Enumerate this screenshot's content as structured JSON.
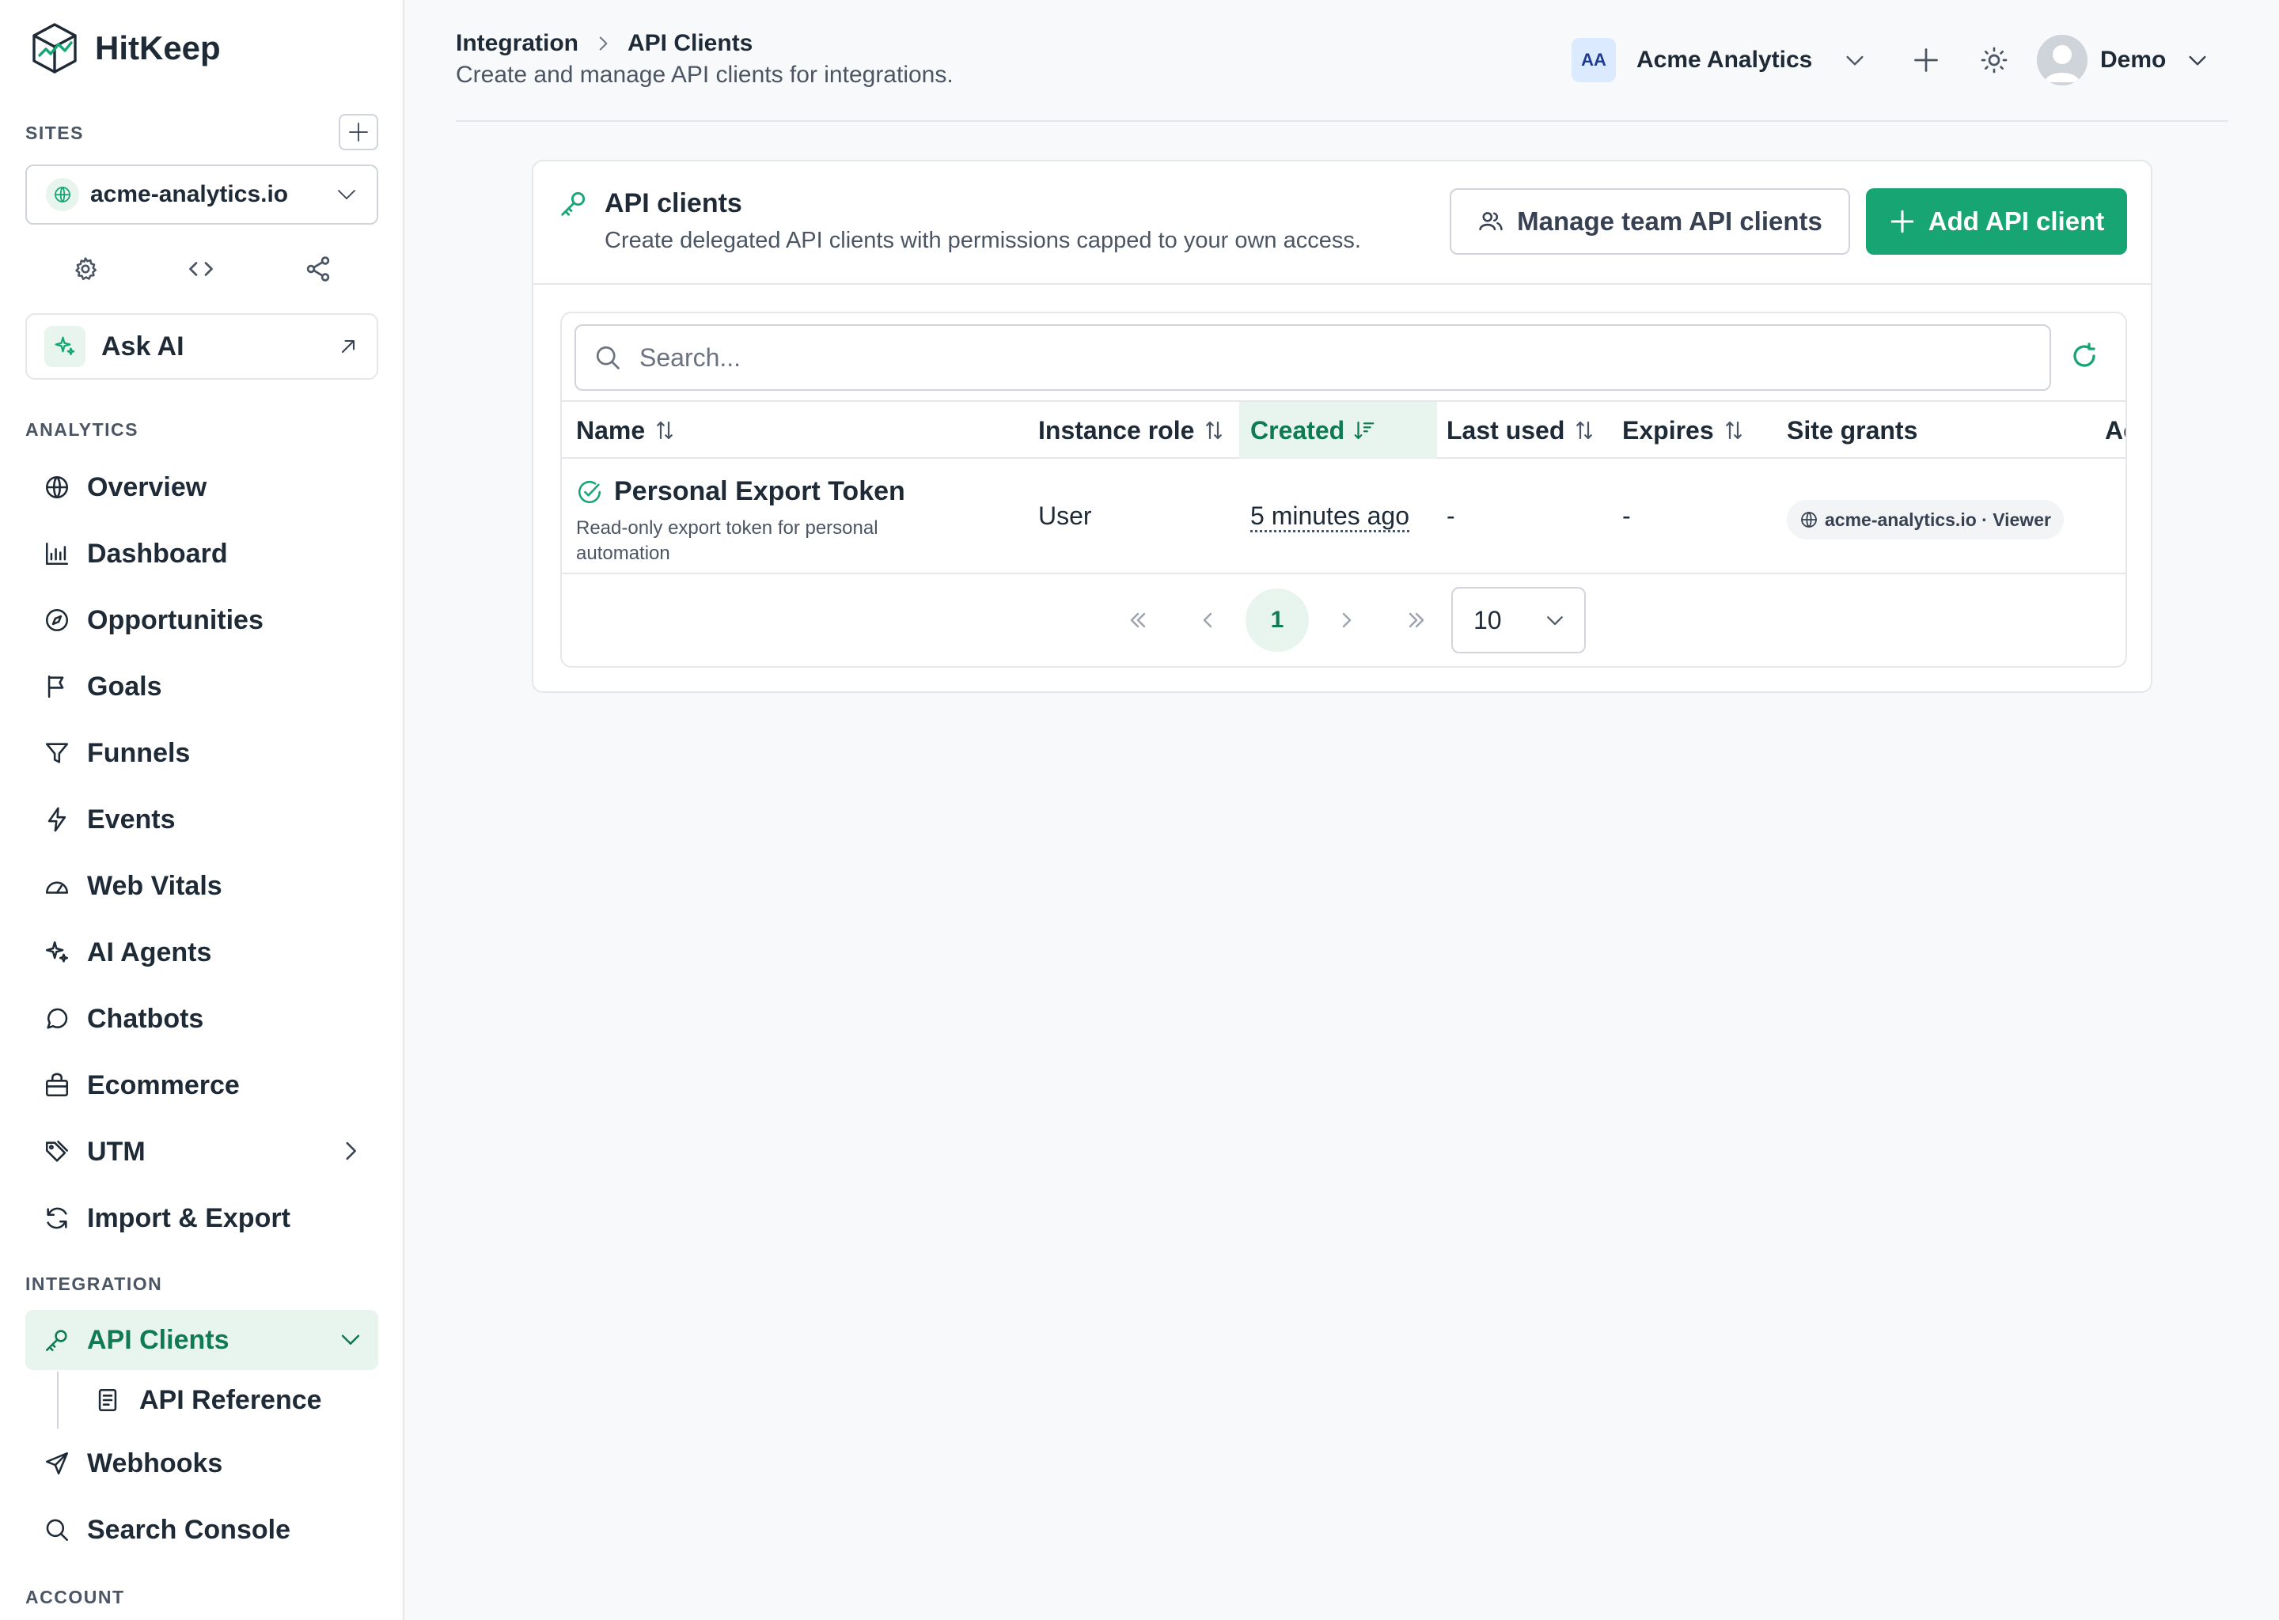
{
  "brand": {
    "name": "HitKeep"
  },
  "sidebar": {
    "sites_label": "SITES",
    "site_selected": "acme-analytics.io",
    "ask_ai_label": "Ask AI",
    "analytics_label": "ANALYTICS",
    "analytics_items": [
      {
        "label": "Overview",
        "icon": "globe-icon"
      },
      {
        "label": "Dashboard",
        "icon": "bar-chart-icon"
      },
      {
        "label": "Opportunities",
        "icon": "compass-icon"
      },
      {
        "label": "Goals",
        "icon": "flag-icon"
      },
      {
        "label": "Funnels",
        "icon": "filter-icon"
      },
      {
        "label": "Events",
        "icon": "bolt-icon"
      },
      {
        "label": "Web Vitals",
        "icon": "gauge-icon"
      },
      {
        "label": "AI Agents",
        "icon": "sparkles-icon"
      },
      {
        "label": "Chatbots",
        "icon": "chat-icon"
      },
      {
        "label": "Ecommerce",
        "icon": "bag-icon"
      },
      {
        "label": "UTM",
        "icon": "tag-icon"
      },
      {
        "label": "Import & Export",
        "icon": "sync-icon"
      }
    ],
    "integration_label": "INTEGRATION",
    "integration_items": [
      {
        "label": "API Clients",
        "icon": "key-icon"
      },
      {
        "label": "API Reference",
        "icon": "document-icon"
      },
      {
        "label": "Webhooks",
        "icon": "send-icon"
      },
      {
        "label": "Search Console",
        "icon": "search-icon"
      }
    ],
    "account_label": "ACCOUNT"
  },
  "header": {
    "breadcrumb_parent": "Integration",
    "breadcrumb_current": "API Clients",
    "subtitle": "Create and manage API clients for integrations.",
    "org_initials": "AA",
    "org_name": "Acme Analytics",
    "user_name": "Demo"
  },
  "card": {
    "title": "API clients",
    "description": "Create delegated API clients with permissions capped to your own access.",
    "manage_button": "Manage team API clients",
    "add_button": "Add API client"
  },
  "table": {
    "search_placeholder": "Search...",
    "columns": [
      "Name",
      "Instance role",
      "Created",
      "Last used",
      "Expires",
      "Site grants",
      "Ac"
    ],
    "sorted_column": "Created",
    "rows": [
      {
        "name": "Personal Export Token",
        "description": "Read-only export token for personal automation",
        "instance_role": "User",
        "created": "5 minutes ago",
        "last_used": "-",
        "expires": "-",
        "site_grant": "acme-analytics.io · Viewer"
      }
    ],
    "current_page": "1",
    "page_size": "10"
  },
  "colors": {
    "accent": "#17a673",
    "accent_dark": "#107a53",
    "accent_bg": "#e8f5ee",
    "page_bg": "#f8f9fa"
  }
}
